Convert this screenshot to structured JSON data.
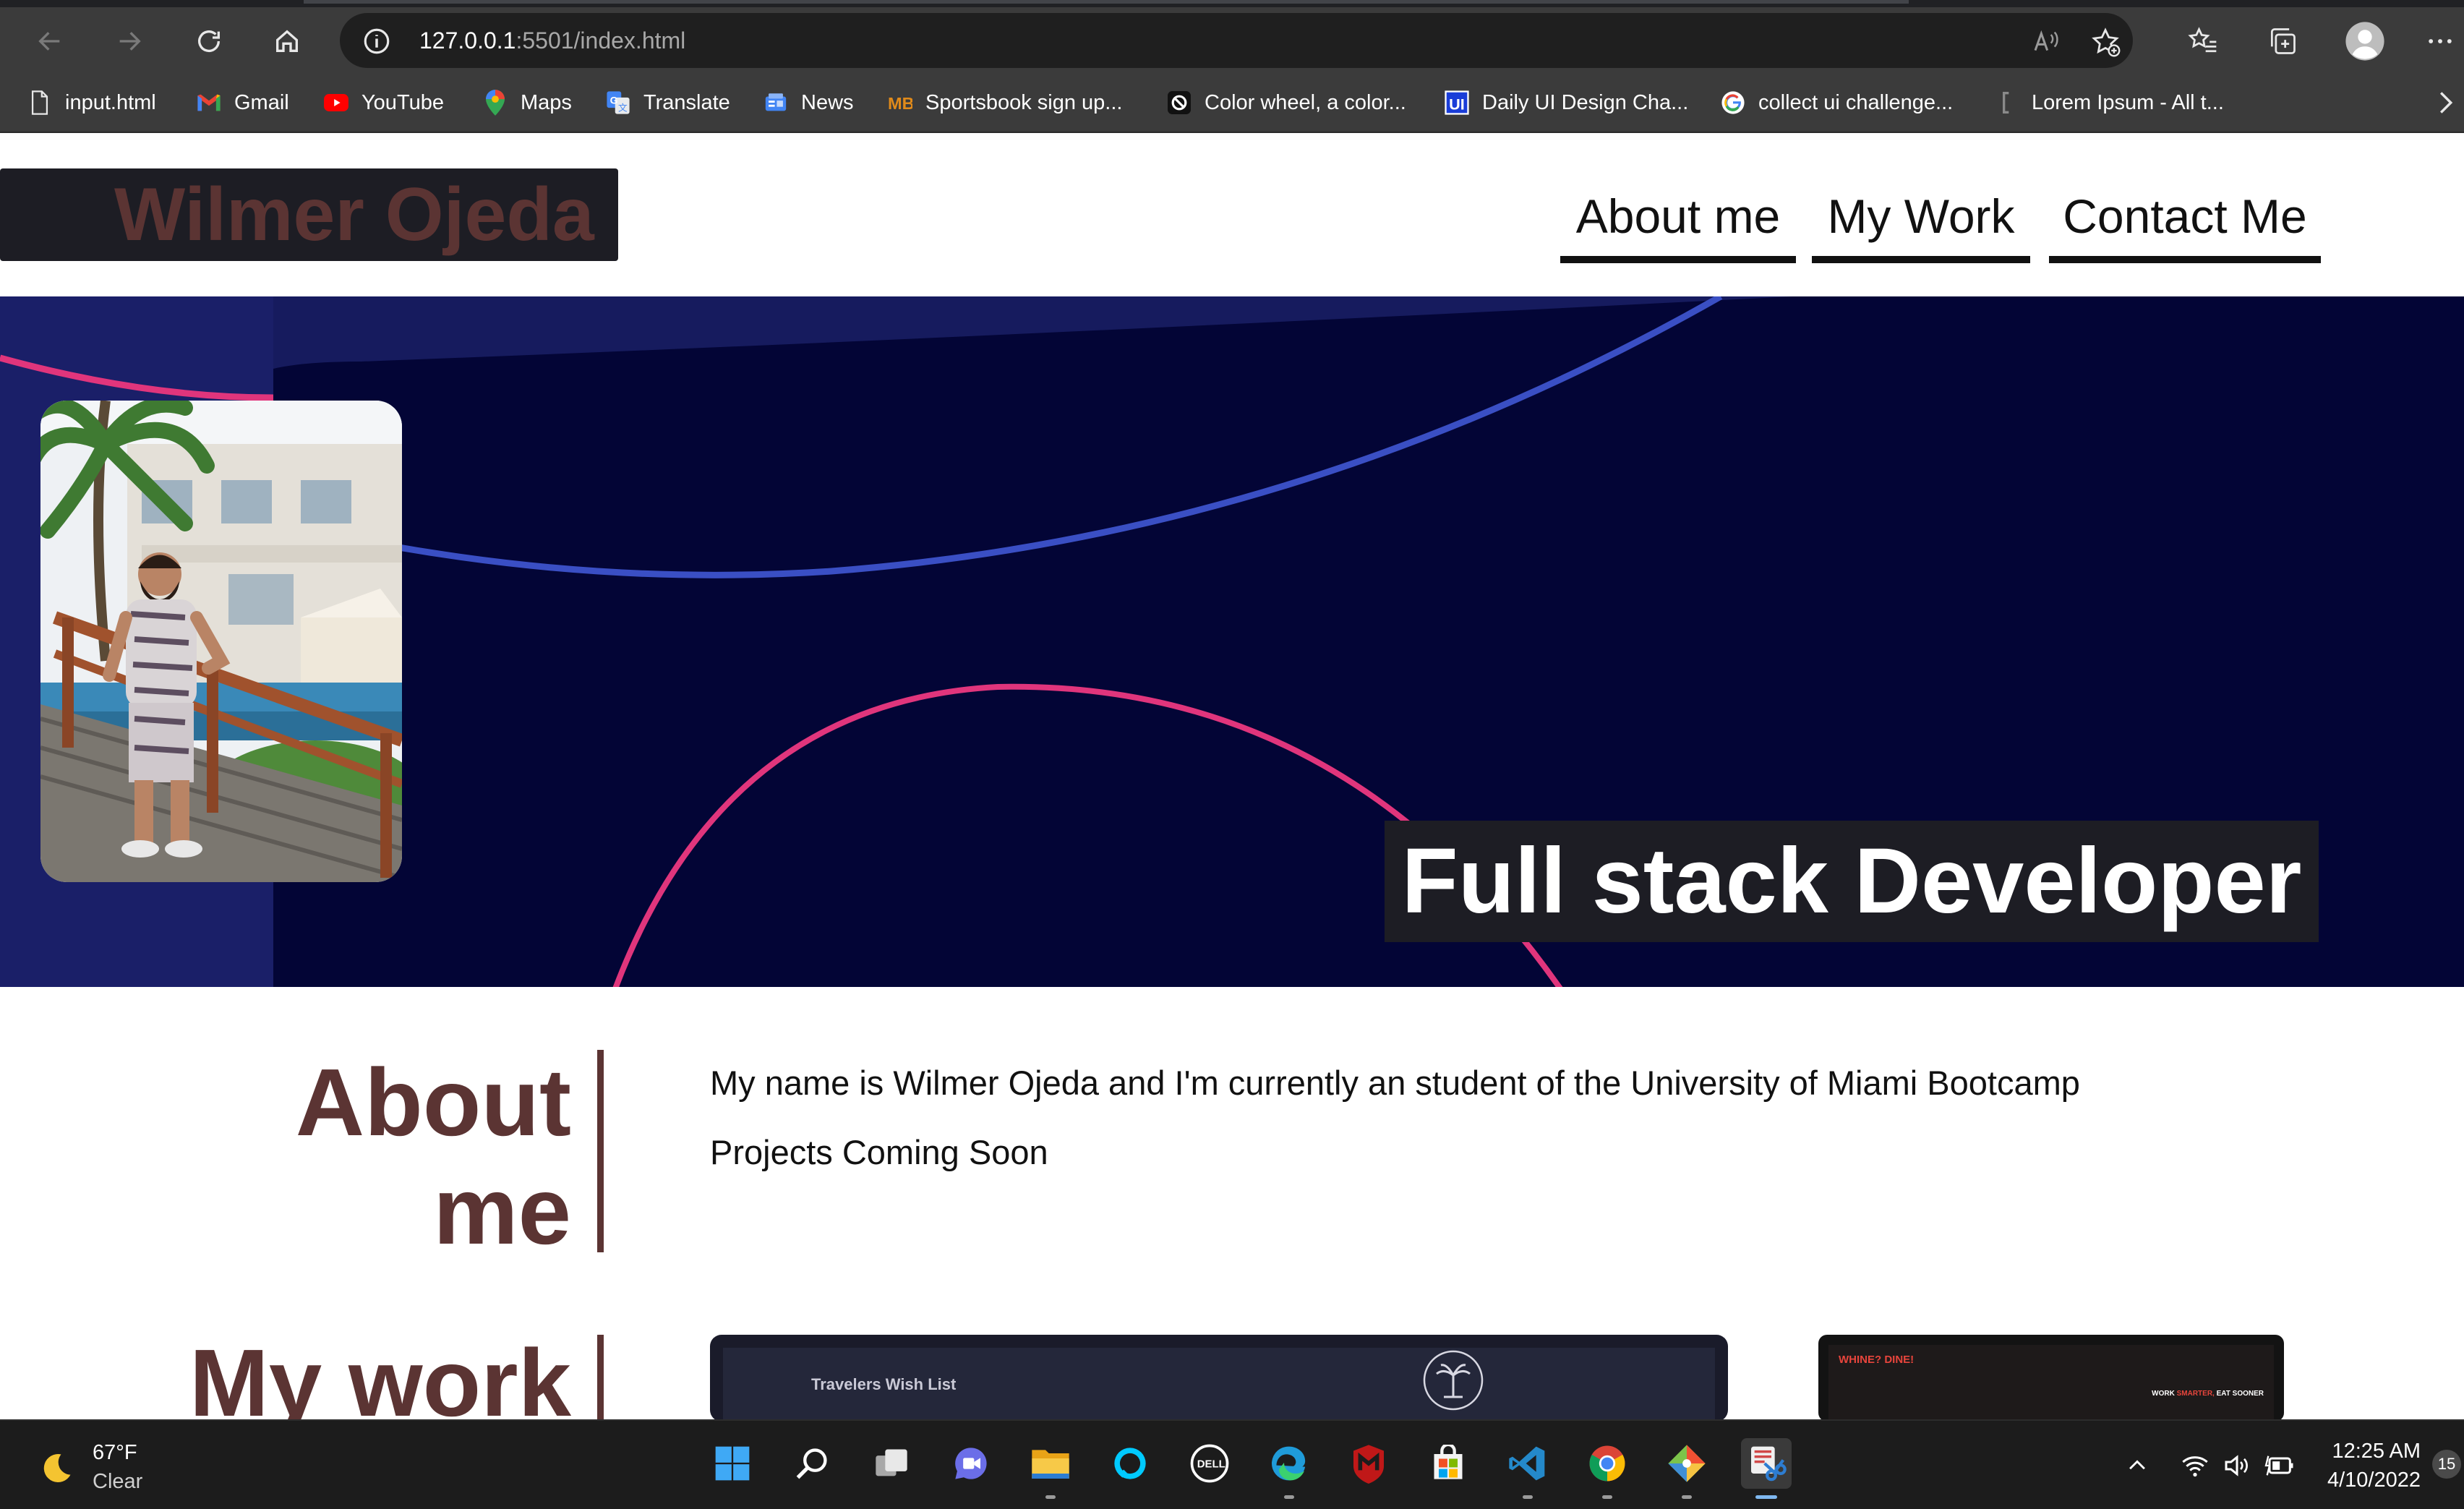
{
  "browser": {
    "url_host": "127.0.0.1",
    "url_rest": ":5501/index.html",
    "bookmarks": [
      {
        "label": "input.html",
        "icon": "file-icon"
      },
      {
        "label": "Gmail",
        "icon": "gmail-icon"
      },
      {
        "label": "YouTube",
        "icon": "youtube-icon"
      },
      {
        "label": "Maps",
        "icon": "maps-icon"
      },
      {
        "label": "Translate",
        "icon": "translate-icon"
      },
      {
        "label": "News",
        "icon": "news-icon"
      },
      {
        "label": "Sportsbook sign up...",
        "icon": "sportsbook-icon"
      },
      {
        "label": "Color wheel, a color...",
        "icon": "colorwheel-icon"
      },
      {
        "label": "Daily UI Design Cha...",
        "icon": "dailyui-icon"
      },
      {
        "label": "collect ui challenge...",
        "icon": "google-icon"
      },
      {
        "label": "Lorem Ipsum - All t...",
        "icon": "lorem-icon"
      }
    ]
  },
  "site": {
    "logo": "Wilmer Ojeda",
    "nav": [
      "About me",
      "My Work",
      "Contact Me"
    ],
    "hero_tagline": "Full stack Developer",
    "about": {
      "title_line1": "About",
      "title_line2": "me",
      "paragraph1": "My name is Wilmer Ojeda and I'm currently an student of the University of Miami Bootcamp",
      "paragraph2": "Projects Coming Soon"
    },
    "work": {
      "title": "My work",
      "project1_title": "Travelers Wish List",
      "project2_title_a": "WHINE?",
      "project2_title_b": "DINE!",
      "project2_tagline_a": "WORK",
      "project2_tagline_b": "SMARTER,",
      "project2_tagline_c": "EAT SOONER"
    }
  },
  "taskbar": {
    "weather_temp": "67°F",
    "weather_condition": "Clear",
    "time": "12:25 AM",
    "date": "4/10/2022",
    "notification_count": "15"
  },
  "colors": {
    "brand_brown": "#5b3433",
    "hero_bg": "#030536",
    "accent_pink": "#e0357c",
    "accent_blue": "#3a4fc4"
  }
}
